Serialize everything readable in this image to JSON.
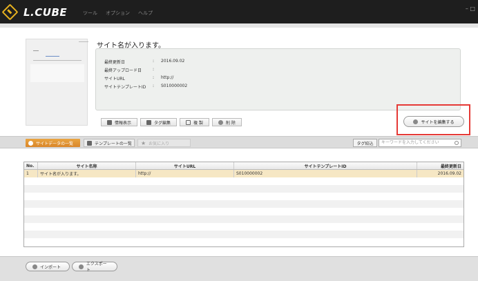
{
  "app": {
    "logo": "L.CUBE",
    "menu": [
      "ツール",
      "オプション",
      "ヘルプ"
    ],
    "window_controls": "– □"
  },
  "site": {
    "title": "サイト名が入ります。",
    "info": [
      {
        "key": "最終更新日",
        "value": "2016.09.02"
      },
      {
        "key": "最終アップロード日",
        "value": ""
      },
      {
        "key": "サイトURL",
        "value": "http://"
      },
      {
        "key": "サイトテンプレートID",
        "value": "S010000002"
      }
    ],
    "colon": ":"
  },
  "actions": {
    "info": "情報表示",
    "tag_edit": "タグ編集",
    "copy": "複 製",
    "delete": "削 除",
    "edit_site": "サイトを編集する"
  },
  "tabs": {
    "site_list": "サイトデータの一覧",
    "template_list": "テンプレートの一覧",
    "favorites": "お気に入り"
  },
  "tag_filter": "タグ絞込",
  "search": {
    "placeholder": "キーワードを入力してください"
  },
  "table": {
    "headers": [
      "No.",
      "サイト名称",
      "サイトURL",
      "サイトテンプレートID",
      "最終更新日"
    ],
    "rows": [
      [
        "1",
        "サイト名が入ります。",
        "http://",
        "S010000002",
        "2016.09.02"
      ]
    ]
  },
  "footer": {
    "import": "インポート",
    "export": "エクスポート"
  },
  "colors": {
    "accent": "#e8b21f",
    "highlight": "#e53935",
    "selected_row": "#f6e7c4"
  }
}
